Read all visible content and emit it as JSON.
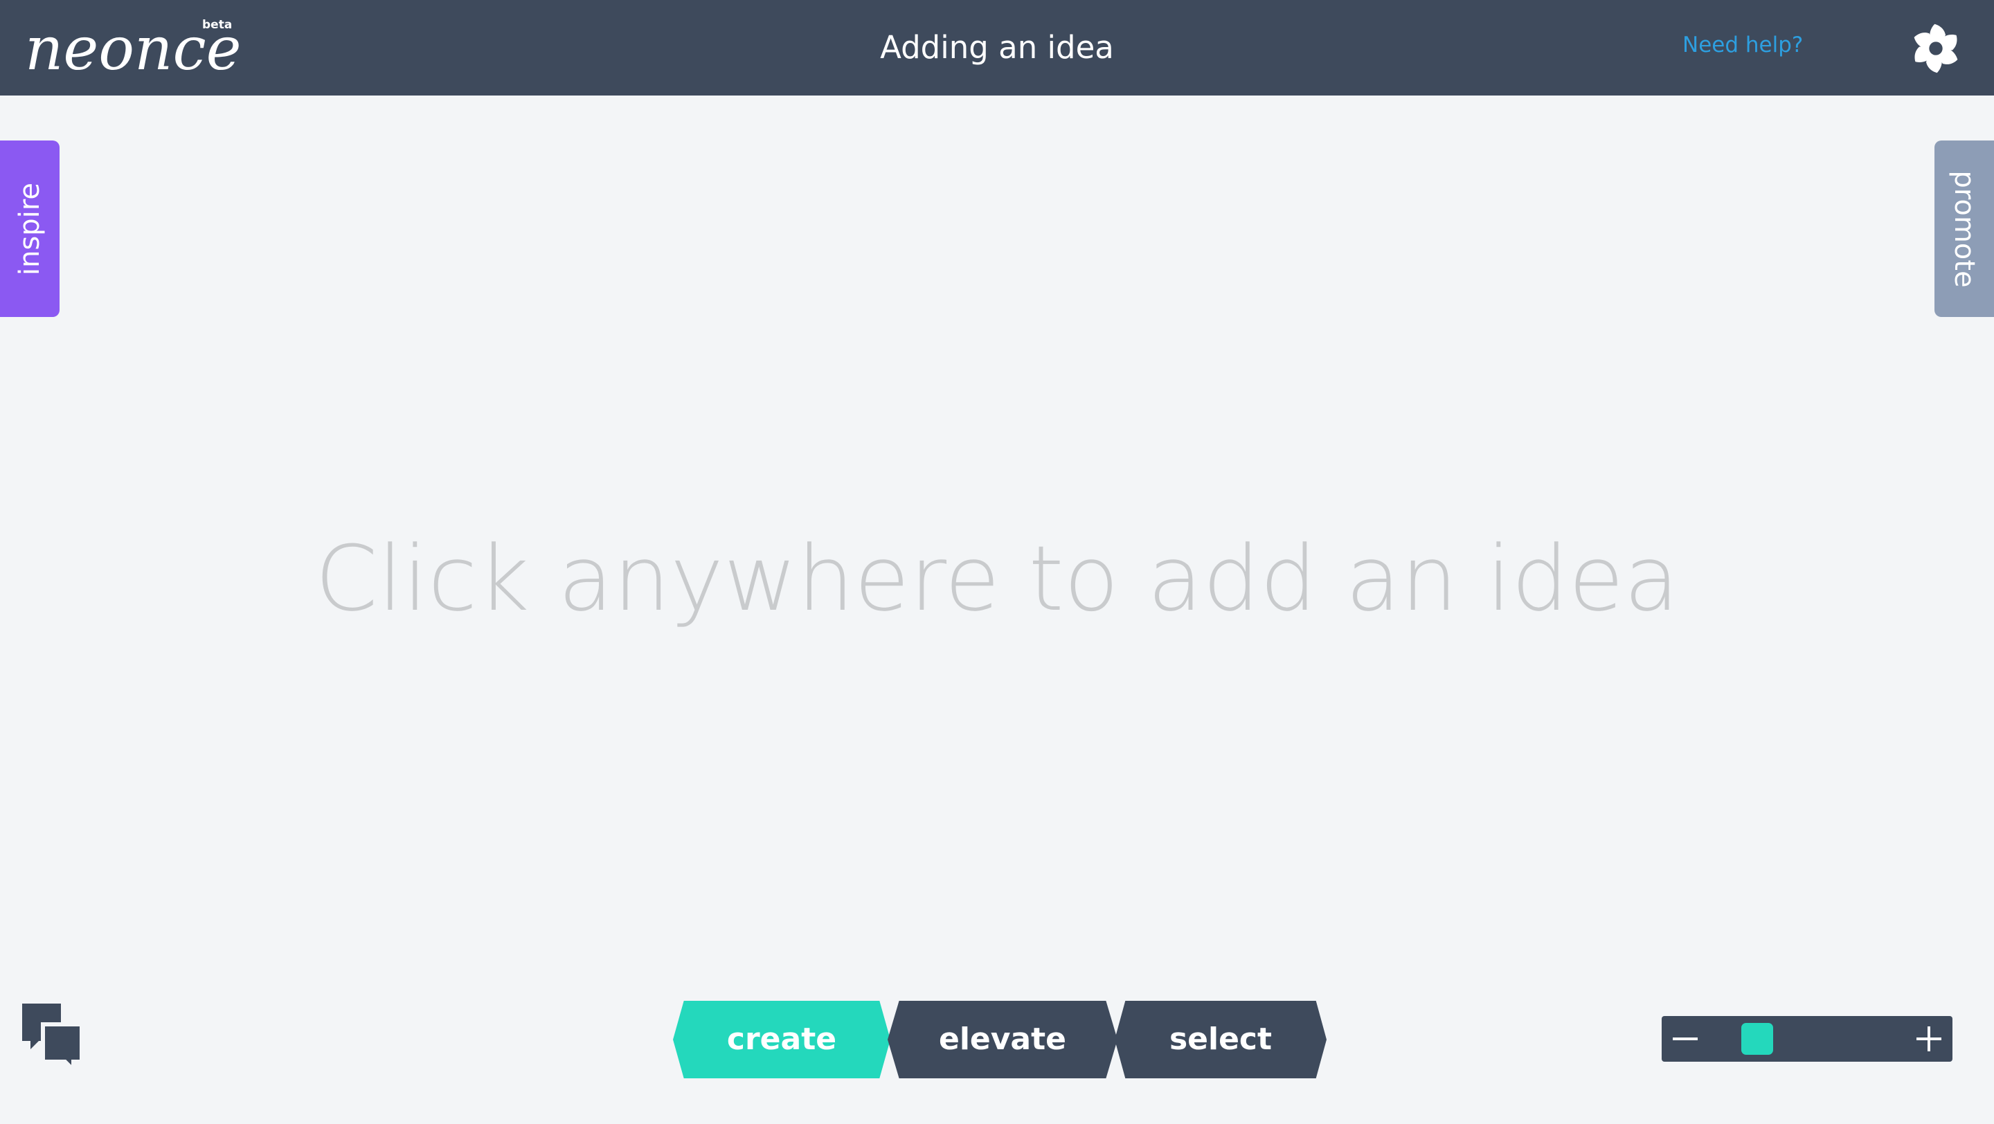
{
  "app": {
    "logo_text": "neonce",
    "beta_label": "beta"
  },
  "header": {
    "title": "Adding an idea",
    "help_label": "Need help?"
  },
  "side_tabs": {
    "inspire_label": "inspire",
    "promote_label": "promote"
  },
  "canvas": {
    "hint": "Click anywhere to add an idea"
  },
  "modes": {
    "active": "create",
    "create_label": "create",
    "elevate_label": "elevate",
    "select_label": "select"
  },
  "zoom": {
    "level": 0.09
  },
  "icons": {
    "settings": "pinwheel-gear-icon",
    "chat": "chat-bubbles-icon",
    "zoom_out": "minus-icon",
    "zoom_in": "plus-icon"
  },
  "colors": {
    "header_bg": "#3e4a5c",
    "page_bg": "#f3f5f7",
    "accent": "#24d8bc",
    "inspire": "#8b59f2",
    "promote": "#8d9db6",
    "help_link": "#2d9fe0",
    "hint_text": "#c9cbcd"
  }
}
